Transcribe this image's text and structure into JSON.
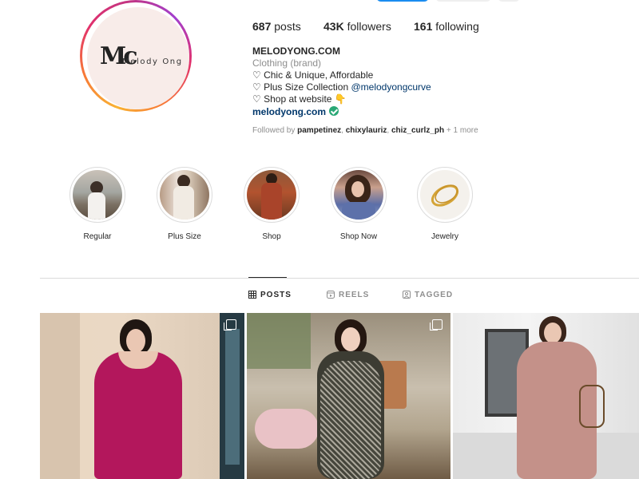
{
  "profile": {
    "logo_mark": "Mc",
    "logo_text": "Melody Ong"
  },
  "stats": {
    "posts_count": "687",
    "posts_label": "posts",
    "followers_count": "43K",
    "followers_label": "followers",
    "following_count": "161",
    "following_label": "following"
  },
  "bio": {
    "name": "MELODYONG.COM",
    "category": "Clothing (brand)",
    "line1": "♡ Chic & Unique, Affordable",
    "line2_prefix": "♡ Plus Size Collection ",
    "line2_handle": "@melodyongcurve",
    "line3": "♡ Shop at website 👇",
    "website": "melodyong.com",
    "followed_prefix": "Followed by ",
    "followed_1": "pampetinez",
    "followed_2": "chixylauriz",
    "followed_3": "chiz_curlz_ph",
    "followed_more": " + 1 more"
  },
  "highlights": [
    {
      "label": "Regular"
    },
    {
      "label": "Plus Size"
    },
    {
      "label": "Shop"
    },
    {
      "label": "Shop Now"
    },
    {
      "label": "Jewelry"
    }
  ],
  "tabs": {
    "posts": "POSTS",
    "reels": "REELS",
    "tagged": "TAGGED"
  },
  "colors": {
    "accent_blue": "#1a8cf0",
    "verified_green": "#2aa876",
    "link_blue": "#00376b"
  }
}
